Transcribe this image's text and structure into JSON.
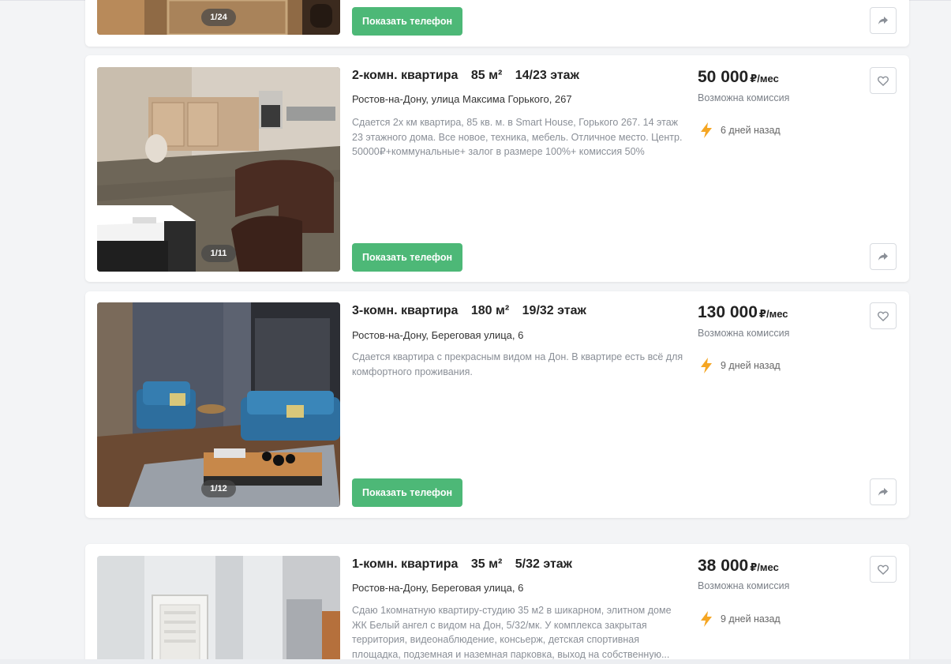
{
  "listings": [
    {
      "photo_counter": "1/24",
      "phone_button": "Показать телефон"
    },
    {
      "rooms": "2-комн. квартира",
      "area": "85 м²",
      "floor": "14/23 этаж",
      "address": "Ростов-на-Дону, улица Максима Горького, 267",
      "description": "Сдается 2х км квартира, 85 кв. м. в Smart House, Горького 267. 14 этаж 23 этажного дома. Все новое, техника, мебель. Отличное место. Центр. 50000₽+коммунальные+ залог в размере 100%+ комиссия 50%",
      "price": "50 000",
      "price_unit": "₽/мес",
      "commission": "Возможна комиссия",
      "age": "6 дней назад",
      "photo_counter": "1/11",
      "phone_button": "Показать телефон"
    },
    {
      "rooms": "3-комн. квартира",
      "area": "180 м²",
      "floor": "19/32 этаж",
      "address": "Ростов-на-Дону, Береговая улица, 6",
      "description": "Сдается квартира с прекрасным видом на Дон. В квартире есть всё для комфортного проживания.",
      "price": "130 000",
      "price_unit": "₽/мес",
      "commission": "Возможна комиссия",
      "age": "9 дней назад",
      "photo_counter": "1/12",
      "phone_button": "Показать телефон"
    },
    {
      "rooms": "1-комн. квартира",
      "area": "35 м²",
      "floor": "5/32 этаж",
      "address": "Ростов-на-Дону, Береговая улица, 6",
      "description": "Сдаю 1комнатную квартиру-студию 35 м2 в шикарном, элитном доме ЖК Белый ангел с видом на Дон, 5/32/мк. У комплекса закрытая территория, видеонаблюдение, консьерж, детская спортивная площадка, подземная и наземная парковка, выход на собственную...",
      "price": "38 000",
      "price_unit": "₽/мес",
      "commission": "Возможна комиссия",
      "age": "9 дней назад"
    }
  ],
  "colors": {
    "accent_green": "#4db877",
    "bolt_orange": "#f5a623",
    "background": "#f3f4f6"
  },
  "icons": {
    "favorite": "heart-icon",
    "share": "share-arrow-icon",
    "freshness": "lightning-icon"
  }
}
